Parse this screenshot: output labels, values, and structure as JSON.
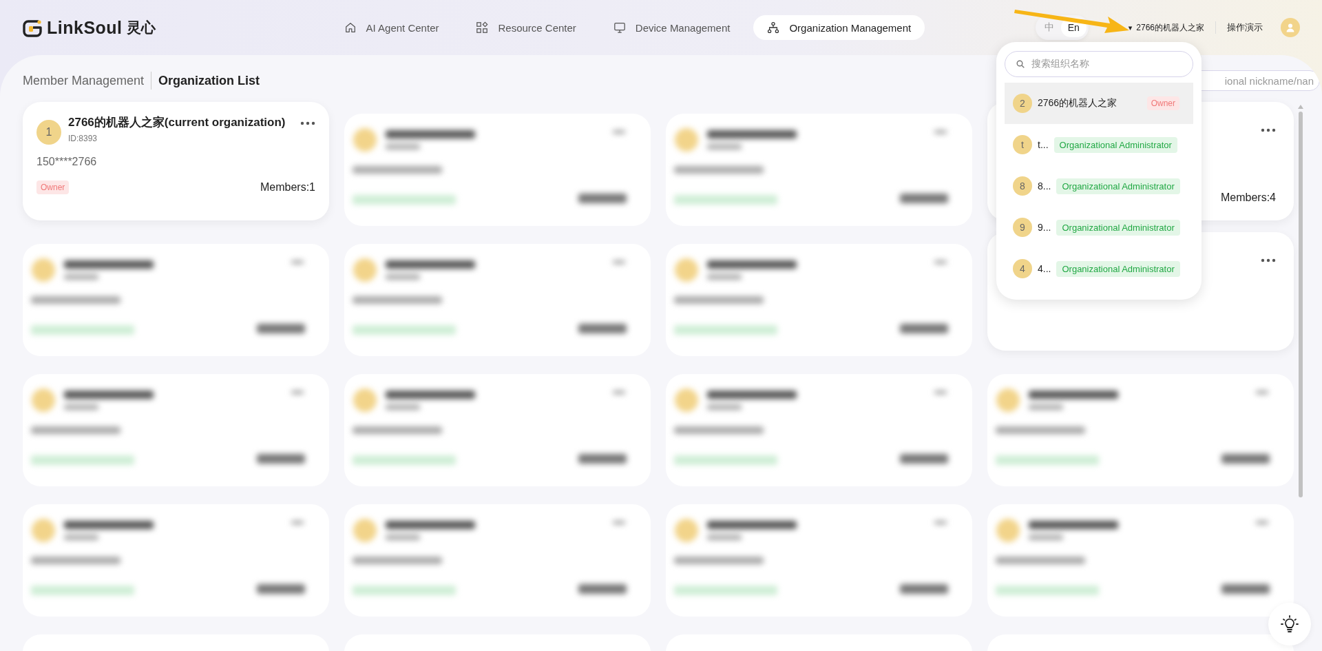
{
  "logo": {
    "name": "LinkSoul",
    "name_cn": "灵心"
  },
  "nav": [
    {
      "label": "AI Agent Center",
      "selected": false
    },
    {
      "label": "Resource Center",
      "selected": false
    },
    {
      "label": "Device Management",
      "selected": false
    },
    {
      "label": "Organization Management",
      "selected": true
    }
  ],
  "language": [
    {
      "label": "中",
      "selected": false
    },
    {
      "label": "En",
      "selected": true
    }
  ],
  "current_org": {
    "caret": "▾",
    "name": "2766的机器人之家"
  },
  "demo_link": "操作演示",
  "page_tabs": [
    {
      "label": "Member Management",
      "selected": false
    },
    {
      "label": "Organization List",
      "selected": true
    }
  ],
  "member_search": {
    "placeholder": "ional nickname/nan"
  },
  "org_cards": [
    {
      "kind": "full",
      "initial": "1",
      "name": "2766的机器人之家(current organization)",
      "id": "ID:8393",
      "phone": "150****2766",
      "role": {
        "label": "Owner",
        "kind": "owner"
      },
      "members": "Members:1"
    },
    {
      "kind": "blurred"
    },
    {
      "kind": "blurred"
    },
    {
      "kind": "partial",
      "members": "Members:4"
    },
    {
      "kind": "blurred"
    },
    {
      "kind": "blurred"
    },
    {
      "kind": "blurred"
    },
    {
      "kind": "partial"
    },
    {
      "kind": "blurred"
    },
    {
      "kind": "blurred"
    },
    {
      "kind": "blurred"
    },
    {
      "kind": "blurred"
    },
    {
      "kind": "blurred"
    },
    {
      "kind": "blurred"
    },
    {
      "kind": "blurred"
    },
    {
      "kind": "blurred"
    },
    {
      "kind": "cut"
    },
    {
      "kind": "cut"
    },
    {
      "kind": "cut"
    },
    {
      "kind": "cut"
    }
  ],
  "org_dropdown": {
    "search": {
      "placeholder": "搜索组织名称"
    },
    "items": [
      {
        "initial": "2",
        "name": "2766的机器人之家",
        "role": {
          "label": "Owner",
          "kind": "owner"
        },
        "selected": true
      },
      {
        "initial": "t",
        "name": "t...",
        "role": {
          "label": "Organizational Administrator",
          "kind": "admin"
        },
        "selected": false
      },
      {
        "initial": "8",
        "name": "8...",
        "role": {
          "label": "Organizational Administrator",
          "kind": "admin"
        },
        "selected": false
      },
      {
        "initial": "9",
        "name": "9...",
        "role": {
          "label": "Organizational Administrator",
          "kind": "admin"
        },
        "selected": false
      },
      {
        "initial": "4",
        "name": "4...",
        "role": {
          "label": "Organizational Administrator",
          "kind": "admin"
        },
        "selected": false
      }
    ]
  }
}
